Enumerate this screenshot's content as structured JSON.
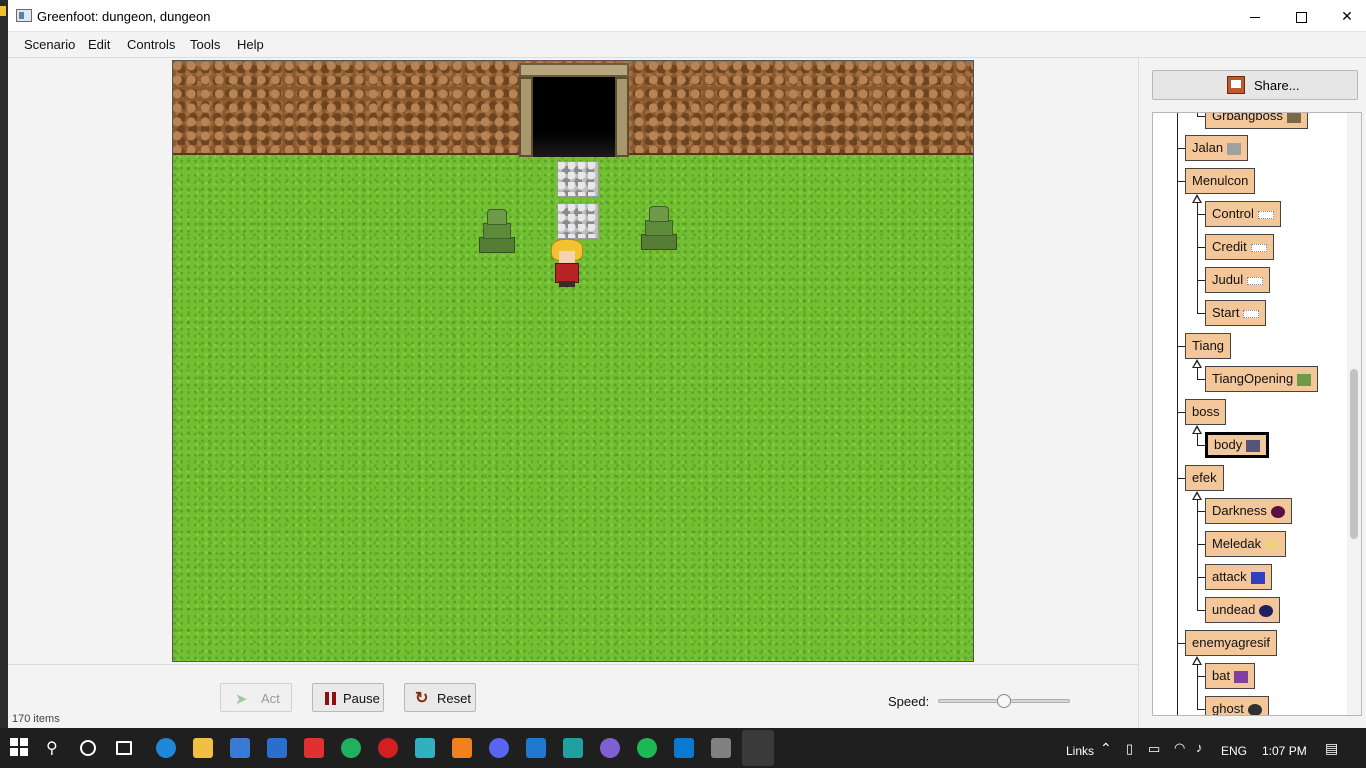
{
  "window": {
    "title": "Greenfoot: dungeon, dungeon"
  },
  "menu": [
    "Scenario",
    "Edit",
    "Controls",
    "Tools",
    "Help"
  ],
  "controls": {
    "act_label": "Act",
    "pause_label": "Pause",
    "reset_label": "Reset",
    "speed_label": "Speed:",
    "speed_value": 0.5
  },
  "status": {
    "text": "170 items"
  },
  "share_label": "Share...",
  "class_tree": [
    {
      "label": "Grbangboss",
      "icon": "boss-tile-icon",
      "icon_color": "#7a6a4a"
    },
    {
      "label": "Jalan",
      "icon": "cobble-icon",
      "icon_color": "#a0a0a0"
    },
    {
      "label": "Menulcon",
      "icon": "",
      "icon_color": ""
    },
    {
      "label": "Control",
      "icon": "text-icon",
      "icon_color": "#ffffff"
    },
    {
      "label": "Credit",
      "icon": "text-icon",
      "icon_color": "#ffffff"
    },
    {
      "label": "Judul",
      "icon": "text-icon",
      "icon_color": "#ffffff"
    },
    {
      "label": "Start",
      "icon": "text-icon",
      "icon_color": "#ffffff"
    },
    {
      "label": "Tiang",
      "icon": "",
      "icon_color": ""
    },
    {
      "label": "TiangOpening",
      "icon": "statue-icon",
      "icon_color": "#6f9a4a"
    },
    {
      "label": "boss",
      "icon": "",
      "icon_color": ""
    },
    {
      "label": "body",
      "icon": "monster-icon",
      "icon_color": "#555577"
    },
    {
      "label": "efek",
      "icon": "",
      "icon_color": ""
    },
    {
      "label": "Darkness",
      "icon": "dark-orb-icon",
      "icon_color": "#5a1040"
    },
    {
      "label": "Meledak",
      "icon": "explosion-icon",
      "icon_color": "#f0d080"
    },
    {
      "label": "attack",
      "icon": "crescent-icon",
      "icon_color": "#3040c0"
    },
    {
      "label": "undead",
      "icon": "dark-orb-icon",
      "icon_color": "#202060"
    },
    {
      "label": "enemyagresif",
      "icon": "",
      "icon_color": ""
    },
    {
      "label": "bat",
      "icon": "bat-icon",
      "icon_color": "#8040a0"
    },
    {
      "label": "ghost",
      "icon": "ghost-icon",
      "icon_color": "#303030"
    }
  ],
  "taskbar": {
    "links_label": "Links",
    "language": "ENG",
    "time": "1:07 PM"
  },
  "colors": {
    "class_fill": "#f4c79b",
    "grass": "#72bf32",
    "cliff": "#8a5a2e"
  }
}
